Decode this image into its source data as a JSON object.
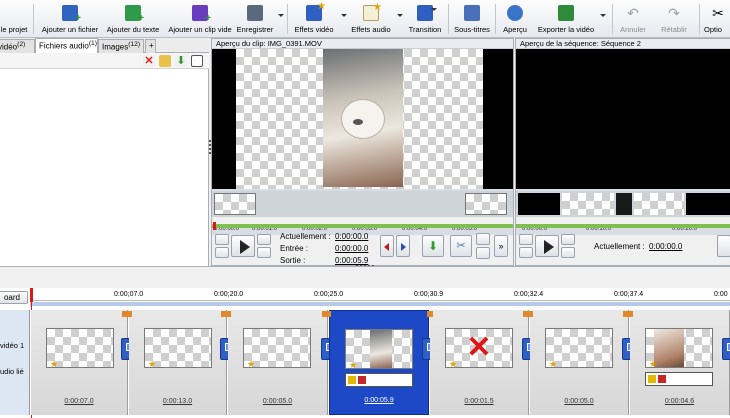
{
  "toolbar": {
    "items": [
      {
        "label": "le projet",
        "icon": "save-project-icon"
      },
      {
        "label": "Ajouter un fichier",
        "icon": "add-file-icon"
      },
      {
        "label": "Ajouter du texte",
        "icon": "add-text-icon"
      },
      {
        "label": "Ajouter un clip vide",
        "icon": "add-blank-clip-icon"
      },
      {
        "label": "Enregistrer",
        "icon": "record-icon"
      },
      {
        "label": "Effets vidéo",
        "icon": "video-effects-icon"
      },
      {
        "label": "Effets audio",
        "icon": "audio-effects-icon"
      },
      {
        "label": "Transition",
        "icon": "transition-icon"
      },
      {
        "label": "Sous-titres",
        "icon": "subtitles-icon"
      },
      {
        "label": "Aperçu",
        "icon": "preview-icon"
      },
      {
        "label": "Exporter la vidéo",
        "icon": "export-video-icon"
      },
      {
        "label": "Annuler",
        "icon": "undo-icon"
      },
      {
        "label": "Rétablir",
        "icon": "redo-icon"
      },
      {
        "label": "Optio",
        "icon": "options-icon"
      }
    ]
  },
  "library": {
    "tabs": [
      {
        "label": "vidéo",
        "count": "(2)"
      },
      {
        "label": "Fichiers audio",
        "count": "(1)"
      },
      {
        "label": "Images",
        "count": "(12)"
      }
    ],
    "add_tab": "+"
  },
  "clip_preview": {
    "title": "Aperçu du clip: IMG_0391.MOV",
    "ruler": [
      "0:00:00.0",
      "0:00:01.0",
      "0:00:02.0",
      "0:00:03.0",
      "0:00:04.0",
      "0:00:05.0"
    ],
    "current_label": "Actuellement :",
    "current_value": "0:00:00.0",
    "in_label": "Entrée :",
    "in_value": "0:00:00.0",
    "out_label": "Sortie :",
    "out_value": "0:00:05.9"
  },
  "sequence_preview": {
    "title": "Aperçu de la séquence: Séquence 2",
    "ruler": [
      "0:00:00.0",
      "0:00:10.0",
      "0:00:20.0"
    ],
    "current_label": "Actuellement :",
    "current_value": "0:00:00.0"
  },
  "timeline": {
    "storyboard_label": "oard",
    "ruler": [
      "0:00;07.0",
      "0:00;20.0",
      "0:00;25.0",
      "0:00;30.9",
      "0:00;32.4",
      "0:00;37.4",
      "0:00"
    ],
    "track_video": "vidéo 1",
    "track_audio": "udio lié",
    "clips": [
      {
        "duration": "0:00:07.0",
        "selected": false,
        "kind": "blank"
      },
      {
        "duration": "0:00:13.0",
        "selected": false,
        "kind": "blank"
      },
      {
        "duration": "0:00:05.0",
        "selected": false,
        "kind": "blank"
      },
      {
        "duration": "0:00:05.9",
        "selected": true,
        "kind": "video"
      },
      {
        "duration": "0:00:01.5",
        "selected": false,
        "kind": "missing"
      },
      {
        "duration": "0:00:05.0",
        "selected": false,
        "kind": "blank"
      },
      {
        "duration": "0:00:04.6",
        "selected": false,
        "kind": "video"
      }
    ]
  },
  "colors": {
    "selection": "#1e49c6",
    "progress_green": "#7fbf4d",
    "missing_red": "#e01515"
  }
}
